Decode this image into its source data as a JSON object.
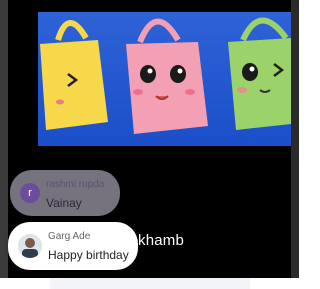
{
  "video": {
    "caption_fragment": "khamb"
  },
  "chat": {
    "messages": [
      {
        "author": "rashmi rupda",
        "avatar_letter": "r",
        "text": "Vainay",
        "faded": true
      },
      {
        "author": "Garg Ade",
        "text": "Happy birthday",
        "faded": false
      }
    ]
  },
  "colors": {
    "thumbnail_background": "#1f55cc",
    "bag_yellow": "#f7d84a",
    "bag_pink": "#f4a0b4",
    "bag_green": "#9bd36a",
    "avatar_purple": "#6b4e9b"
  }
}
